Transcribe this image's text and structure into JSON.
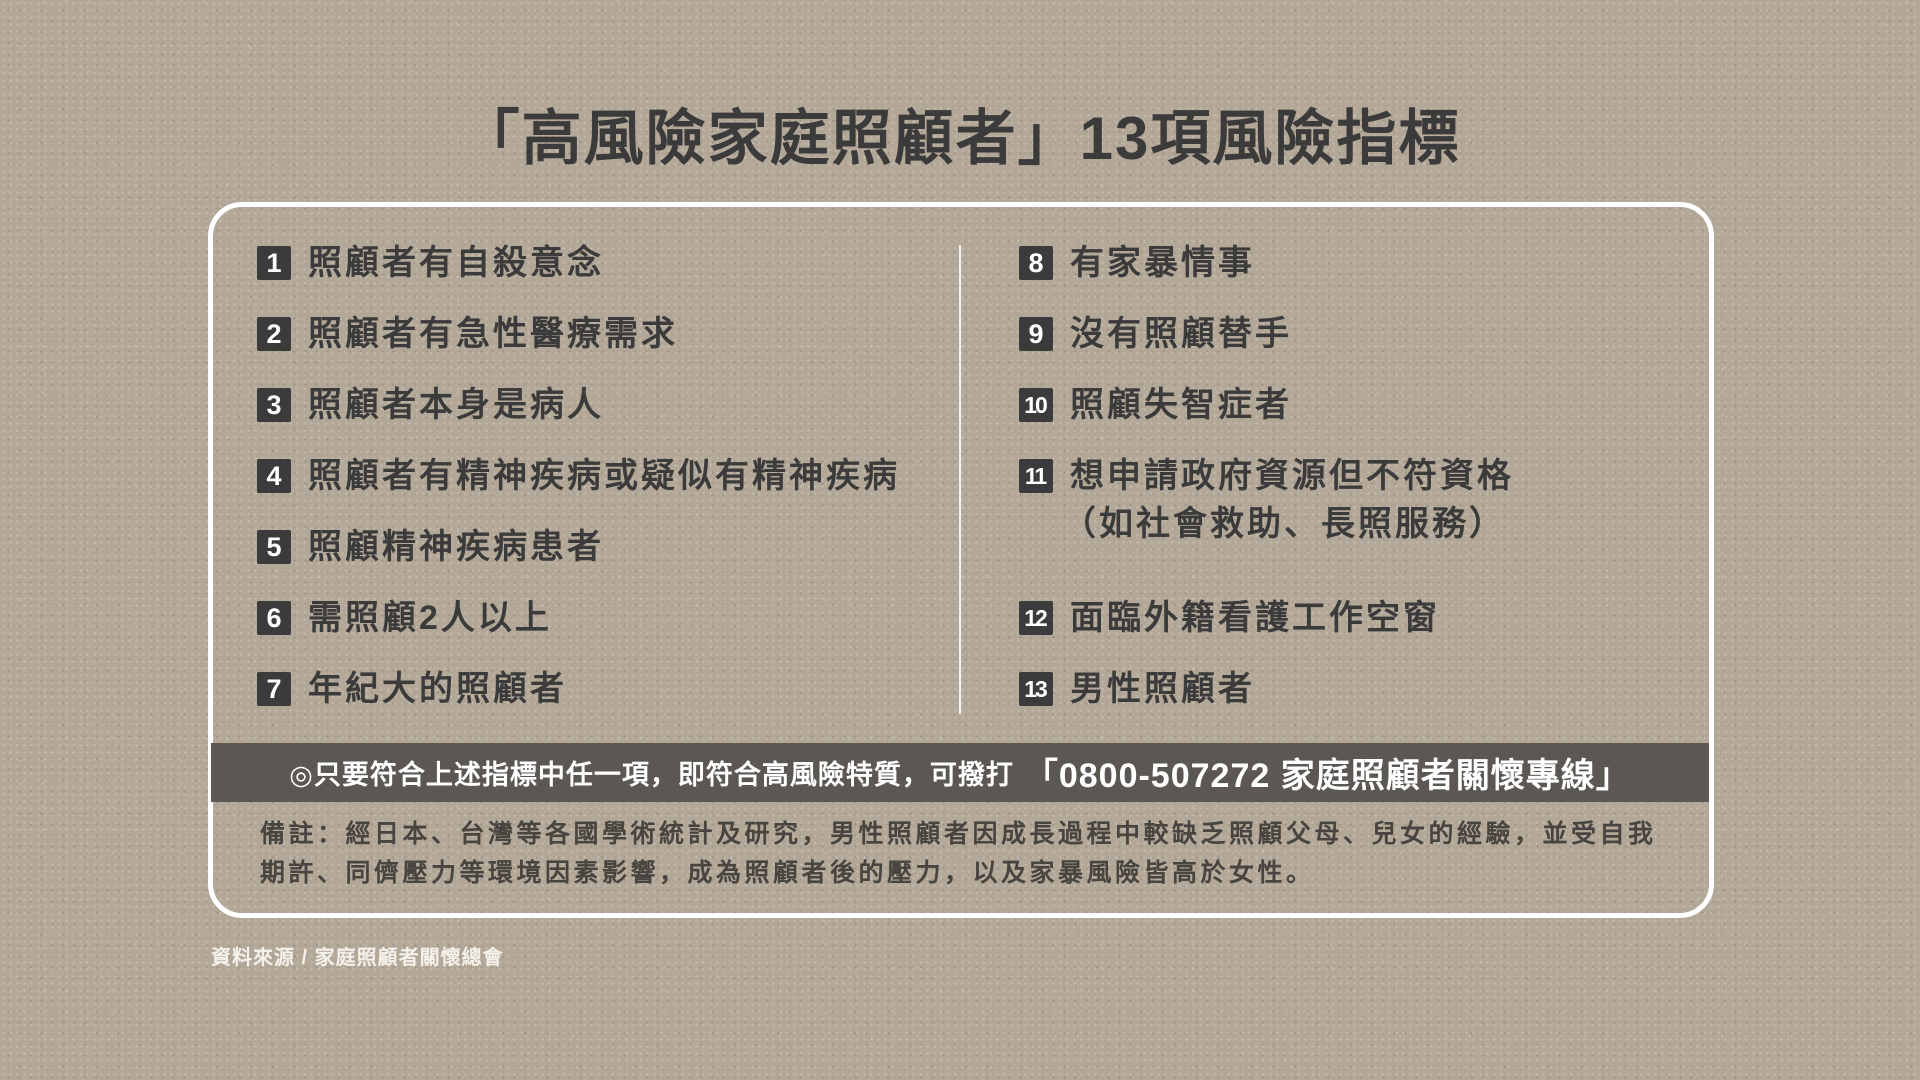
{
  "title": "「高風險家庭照顧者」13項風險指標",
  "indicators": {
    "left": [
      {
        "num": "1",
        "text": "照顧者有自殺意念"
      },
      {
        "num": "2",
        "text": "照顧者有急性醫療需求"
      },
      {
        "num": "3",
        "text": "照顧者本身是病人"
      },
      {
        "num": "4",
        "text": "照顧者有精神疾病或疑似有精神疾病"
      },
      {
        "num": "5",
        "text": "照顧精神疾病患者"
      },
      {
        "num": "6",
        "text": "需照顧2人以上"
      },
      {
        "num": "7",
        "text": "年紀大的照顧者"
      }
    ],
    "right": [
      {
        "num": "8",
        "text": "有家暴情事"
      },
      {
        "num": "9",
        "text": "沒有照顧替手"
      },
      {
        "num": "10",
        "text": "照顧失智症者"
      },
      {
        "num": "11",
        "text": "想申請政府資源但不符資格",
        "subtext": "（如社會救助、長照服務）"
      },
      {
        "num": "12",
        "text": "面臨外籍看護工作空窗"
      },
      {
        "num": "13",
        "text": "男性照顧者"
      }
    ]
  },
  "band": {
    "prefix": "◎只要符合上述指標中任一項，即符合高風險特質，可撥打",
    "hotline": "「0800-507272 家庭照顧者關懷專線」"
  },
  "note": {
    "lines": [
      "備註：經日本、台灣等各國學術統計及研究，男性照顧者因成長過程中較缺乏照顧父母、兒女的經驗，並受自我",
      "期許、同儕壓力等環境因素影響，成為照顧者後的壓力，以及家暴風險皆高於女性。"
    ]
  },
  "source": "資料來源 / 家庭照顧者關懷總會",
  "colors": {
    "background": "#b3a898",
    "ink": "#3b3b3b",
    "band": "#5b5753",
    "frame": "#ffffff"
  }
}
